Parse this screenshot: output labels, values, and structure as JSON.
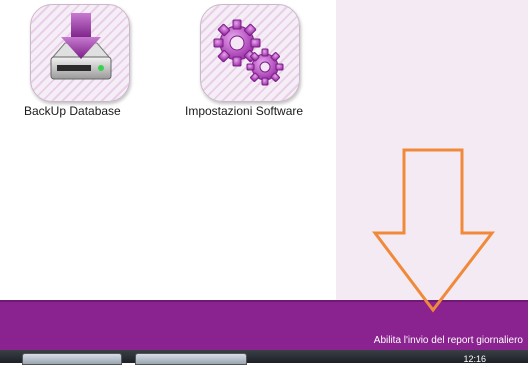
{
  "tiles": [
    {
      "label": "BackUp Database",
      "icon": "database-backup-icon"
    },
    {
      "label": "Impostazioni Software",
      "icon": "gears-icon"
    }
  ],
  "bottom_bar": {
    "report_link": "Abilita l'invio del report giornaliero",
    "color": "#8a2290"
  },
  "annotation": {
    "icon": "down-arrow-annotation-icon",
    "color": "#f08a3a"
  },
  "taskbar": {
    "time": "12:16"
  }
}
